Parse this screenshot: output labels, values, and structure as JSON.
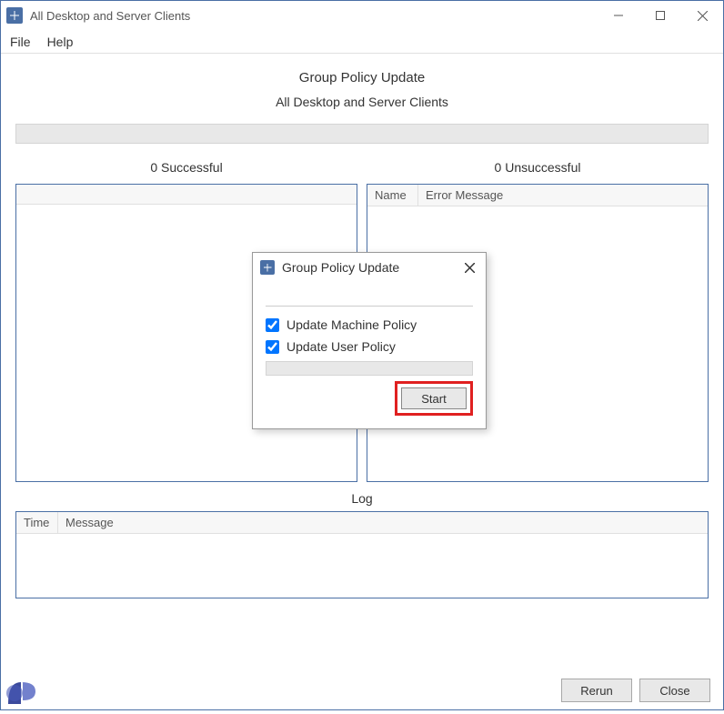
{
  "window": {
    "title": "All Desktop and Server Clients"
  },
  "menubar": {
    "file": "File",
    "help": "Help"
  },
  "main": {
    "heading": "Group Policy Update",
    "subheading": "All Desktop and Server Clients",
    "successful_label": "0 Successful",
    "unsuccessful_label": "0 Unsuccessful",
    "right_headers": {
      "name": "Name",
      "error": "Error Message"
    },
    "log_label": "Log",
    "log_headers": {
      "time": "Time",
      "message": "Message"
    }
  },
  "footer": {
    "rerun": "Rerun",
    "close": "Close"
  },
  "dialog": {
    "title": "Group Policy Update",
    "opt_machine": "Update Machine Policy",
    "opt_user": "Update User Policy",
    "machine_checked": true,
    "user_checked": true,
    "start": "Start"
  }
}
